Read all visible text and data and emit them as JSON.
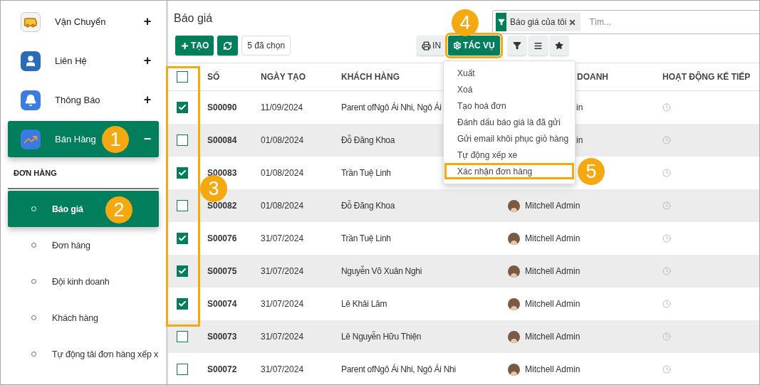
{
  "sidebar": {
    "apps": [
      {
        "label": "Vận Chuyển",
        "kind": "bus",
        "sign": "+",
        "selected": false
      },
      {
        "label": "Liên Hệ",
        "kind": "contact",
        "sign": "+",
        "selected": false
      },
      {
        "label": "Thông Báo",
        "kind": "bell",
        "sign": "+",
        "selected": false
      },
      {
        "label": "Bán Hàng",
        "kind": "chart",
        "sign": "−",
        "selected": true
      }
    ],
    "section_title": "ĐƠN HÀNG",
    "items": [
      {
        "label": "Báo giá",
        "selected": true
      },
      {
        "label": "Đơn hàng",
        "selected": false
      },
      {
        "label": "Đội kinh doanh",
        "selected": false
      },
      {
        "label": "Khách hàng",
        "selected": false
      },
      {
        "label": "Tự động tải đơn hàng xếp x",
        "selected": false
      }
    ]
  },
  "page_title": "Báo giá",
  "search": {
    "facet": "Báo giá của tôi",
    "placeholder": "Tìm..."
  },
  "toolbar": {
    "create": "TẠO",
    "selection": "5 đã chọn",
    "print": "IN",
    "action": "TÁC VỤ",
    "action_highlighted": true
  },
  "action_menu": [
    {
      "label": "Xuất",
      "highlighted": false
    },
    {
      "label": "Xoá",
      "highlighted": false
    },
    {
      "label": "Tạo hoá đơn",
      "highlighted": false
    },
    {
      "label": "Đánh dấu báo giá là đã gửi",
      "highlighted": false
    },
    {
      "label": "Gửi email khôi phục giỏ hàng",
      "highlighted": false
    },
    {
      "label": "Tự động xếp xe",
      "highlighted": false
    },
    {
      "label": "Xác nhận đơn hàng",
      "highlighted": true
    }
  ],
  "table": {
    "header_checked": false,
    "columns": [
      "SỐ",
      "NGÀY TẠO",
      "KHÁCH HÀNG",
      "DOANH",
      "HOẠT ĐỘNG KẾ TIẾP"
    ],
    "rows": [
      {
        "checked": true,
        "number": "S00090",
        "date": "11/09/2024",
        "customer": "Parent ofNgô Ái Nhi, Ngô Ái",
        "salesperson": "in",
        "avatar": false
      },
      {
        "checked": false,
        "number": "S00084",
        "date": "01/08/2024",
        "customer": "Đỗ Đăng Khoa",
        "salesperson": "in",
        "avatar": false
      },
      {
        "checked": true,
        "number": "S00083",
        "date": "01/08/2024",
        "customer": "Trần Tuệ Linh"
      },
      {
        "checked": false,
        "number": "S00082",
        "date": "01/08/2024",
        "customer": "Đỗ Đăng Khoa",
        "salesperson": "Mitchell Admin",
        "avatar": true
      },
      {
        "checked": true,
        "number": "S00076",
        "date": "31/07/2024",
        "customer": "Trần Tuệ Linh",
        "salesperson": "Mitchell Admin",
        "avatar": true
      },
      {
        "checked": true,
        "number": "S00075",
        "date": "31/07/2024",
        "customer": "Nguyễn Võ Xuân Nghi",
        "salesperson": "Mitchell Admin",
        "avatar": true
      },
      {
        "checked": true,
        "number": "S00074",
        "date": "31/07/2024",
        "customer": "Lê Khải Lâm",
        "salesperson": "Mitchell Admin",
        "avatar": true
      },
      {
        "checked": false,
        "number": "S00073",
        "date": "31/07/2024",
        "customer": "Lê Nguyễn Hữu Thiện",
        "salesperson": "Mitchell Admin",
        "avatar": true
      },
      {
        "checked": false,
        "number": "S00072",
        "date": "31/07/2024",
        "customer": "Parent ofNgô Ái Nhi, Ngô Ái Nhi",
        "salesperson": "Mitchell Admin",
        "avatar": true
      }
    ]
  },
  "callouts": [
    "1",
    "2",
    "3",
    "4",
    "5"
  ]
}
